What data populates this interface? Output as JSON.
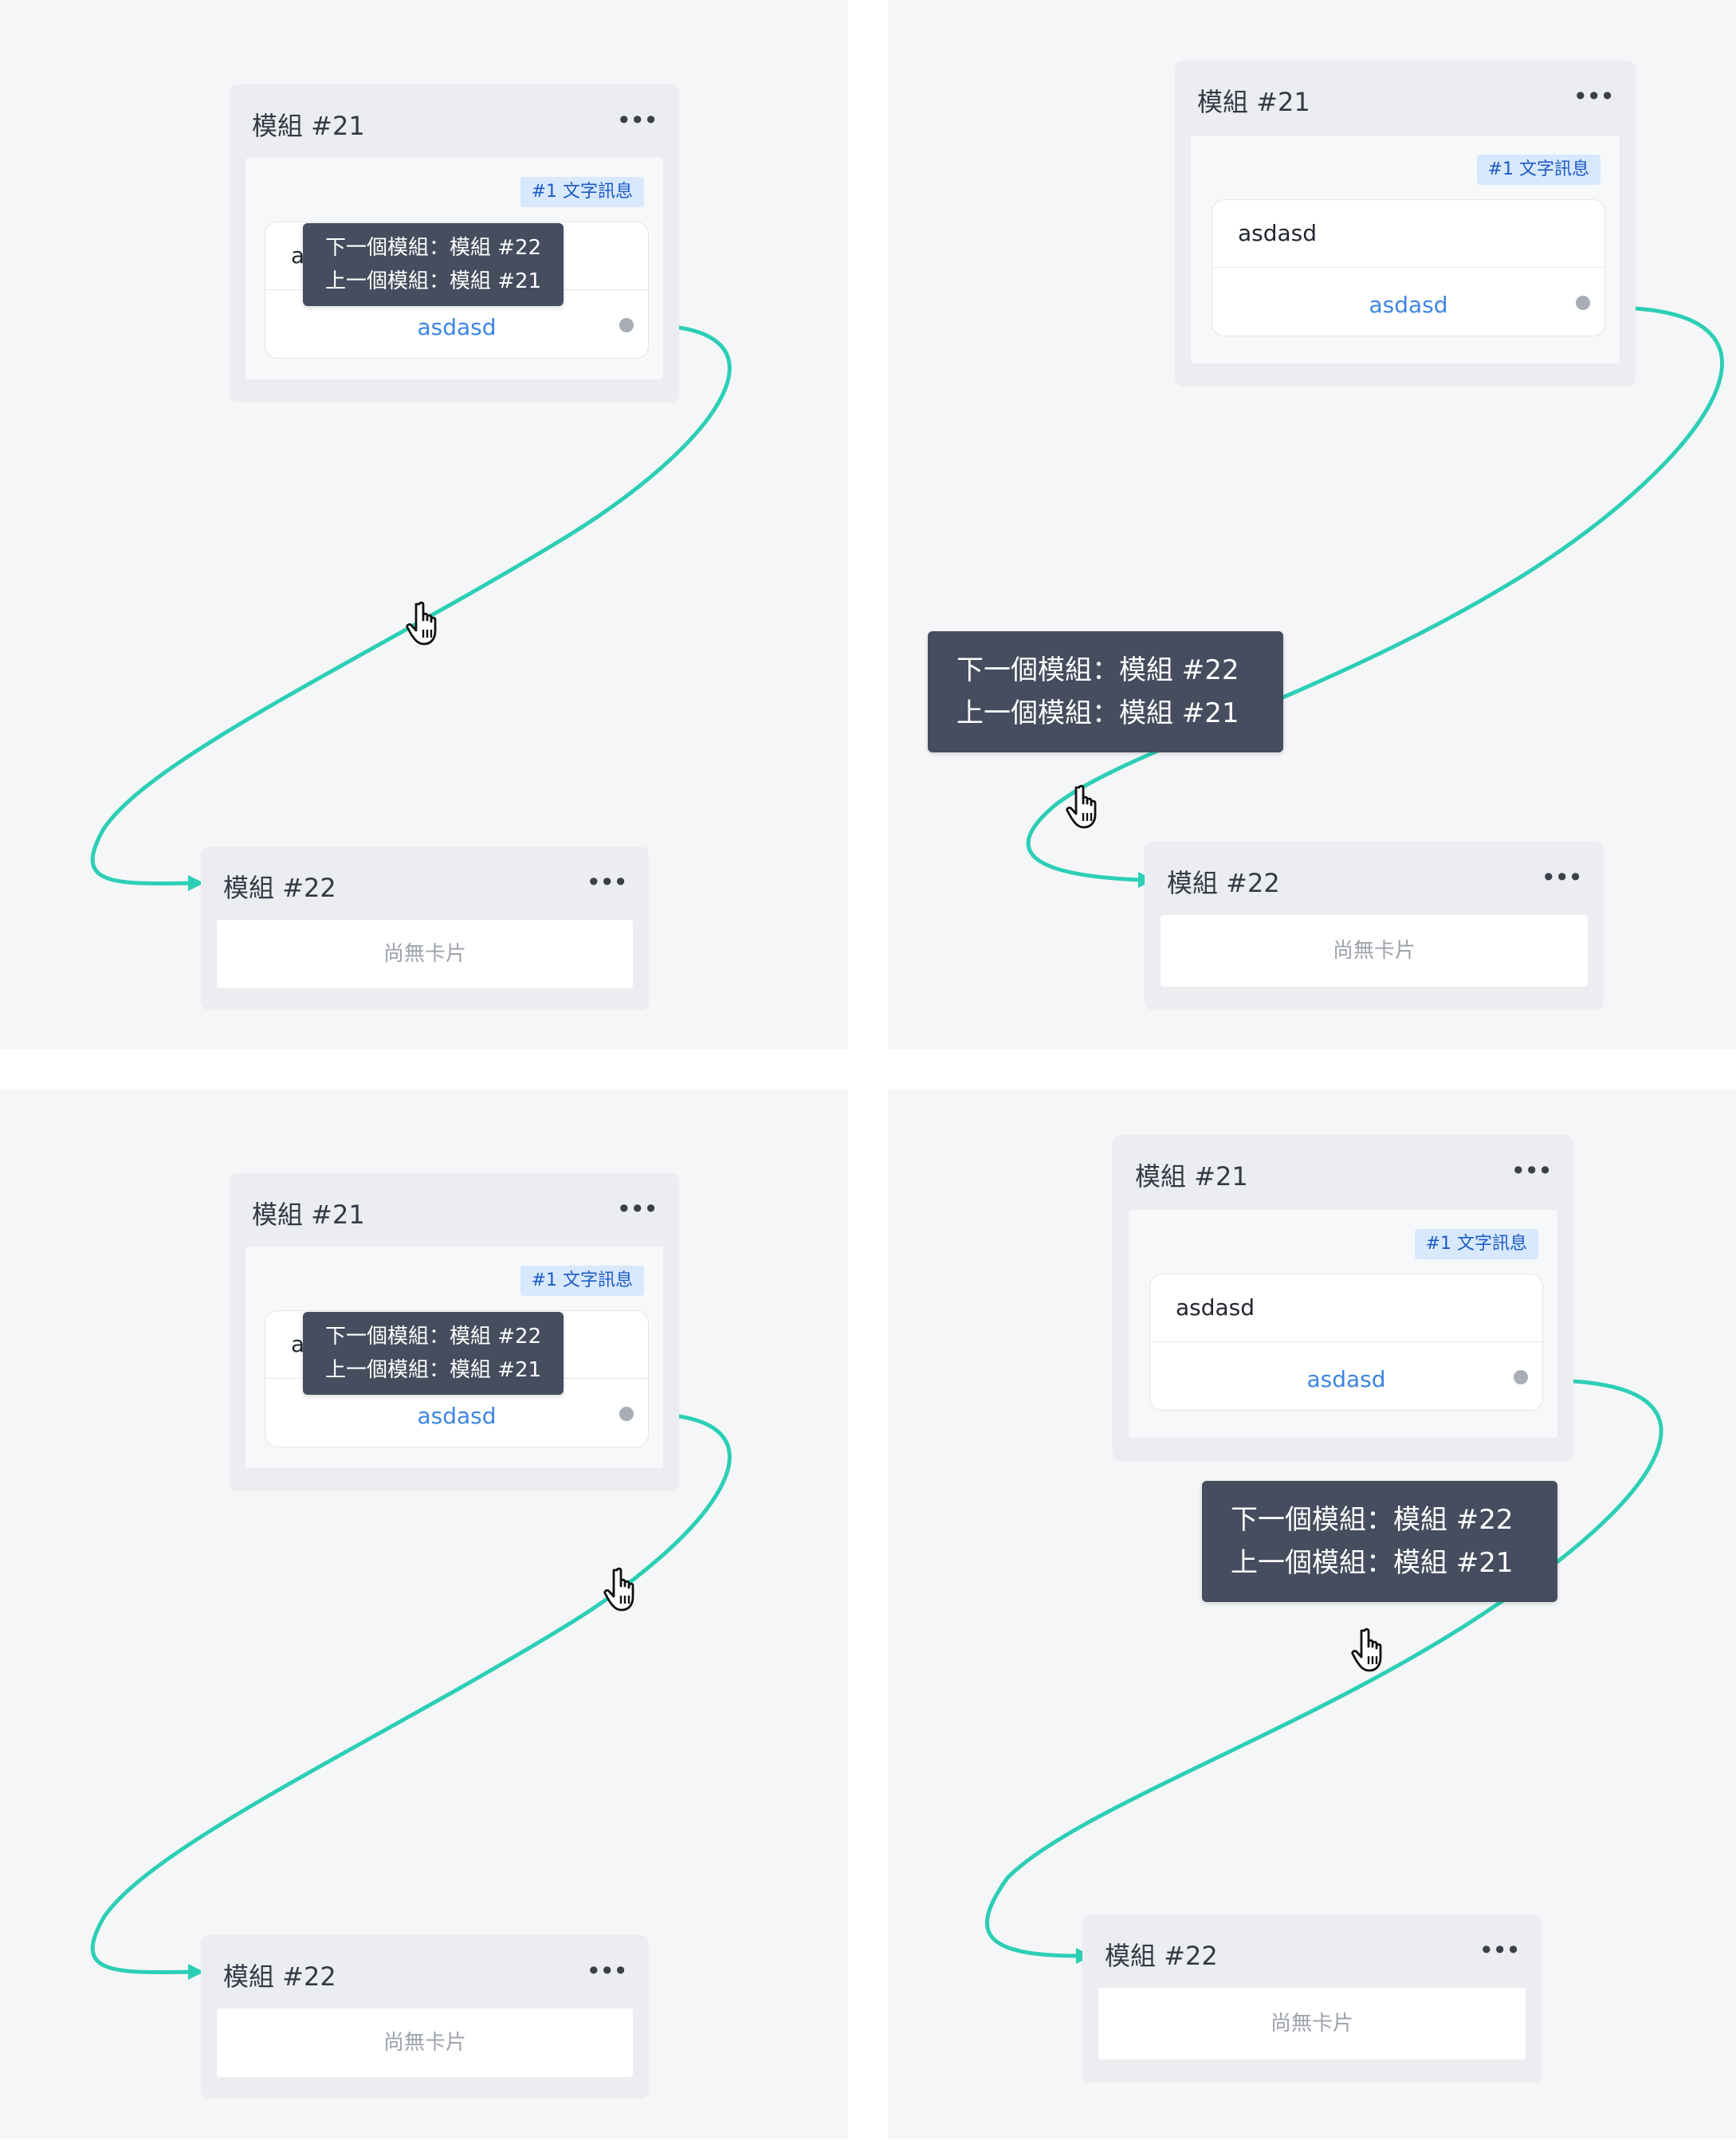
{
  "modules": {
    "source": {
      "title": "模組 #21",
      "menu_icon": "more-icon",
      "badge": "#1 文字訊息",
      "card_text": "asdasd",
      "card_button": "asdasd"
    },
    "target": {
      "title": "模組 #22",
      "menu_icon": "more-icon",
      "empty_text": "尚無卡片"
    }
  },
  "tooltip": {
    "next_line": "下一個模組：模組 #22",
    "prev_line": "上一個模組：模組 #21"
  },
  "colors": {
    "connector": "#2ccfb5",
    "badge_bg": "#d8e8fd",
    "badge_text": "#1c5bc6",
    "tooltip_bg": "#454d5e",
    "button_text": "#3d86e2"
  },
  "cursor_icon": "hand-pointer-icon"
}
